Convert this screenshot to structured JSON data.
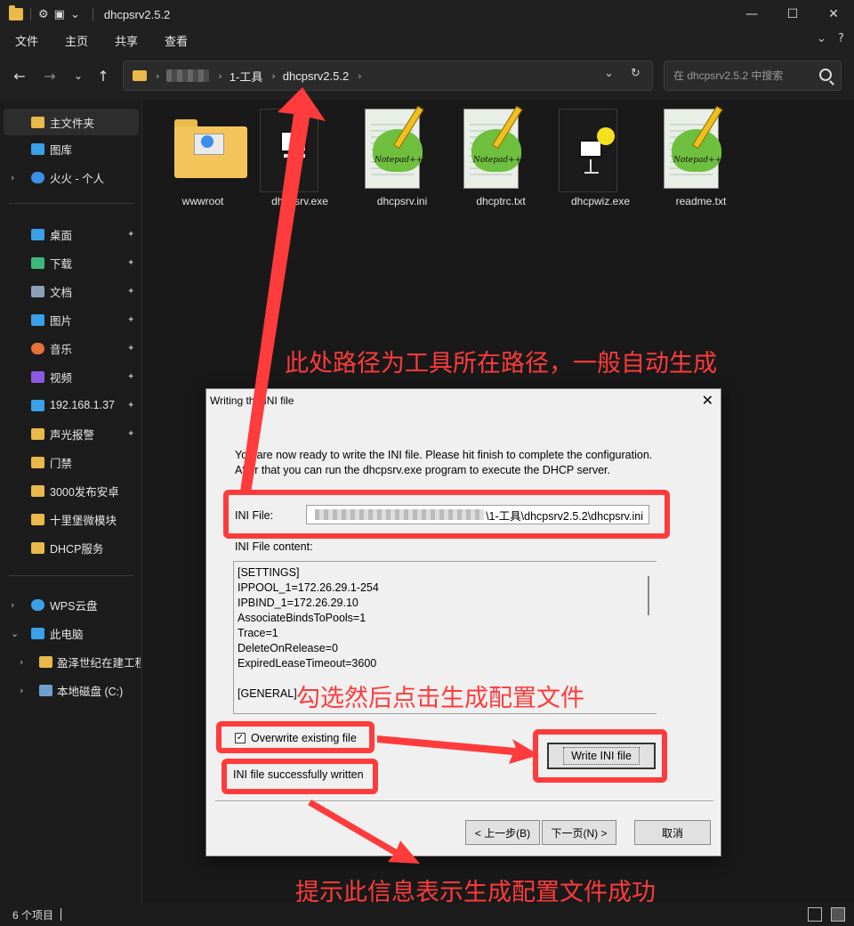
{
  "window": {
    "title": "dhcpsrv2.5.2",
    "minimize_glyph": "—",
    "maximize_glyph": "☐",
    "close_glyph": "✕"
  },
  "menu": {
    "items": [
      "文件",
      "主页",
      "共享",
      "查看"
    ],
    "collapse_glyph": "⌄",
    "help_glyph": "?"
  },
  "nav": {
    "breadcrumb": [
      "1-工具",
      "dhcpsrv2.5.2"
    ],
    "search_placeholder": "在 dhcpsrv2.5.2 中搜索"
  },
  "sidebar": {
    "items": [
      {
        "label": "主文件夹",
        "icon": "home-icon",
        "color": "#e9b949",
        "selected": true
      },
      {
        "label": "图库",
        "icon": "gallery-icon",
        "color": "#3aa0e8"
      },
      {
        "label": "火火 - 个人",
        "icon": "onedrive-icon",
        "color": "#3a8fe8",
        "chevron": "›"
      },
      {
        "label": "桌面",
        "icon": "desktop-icon",
        "color": "#3aa0e8",
        "pinned": true
      },
      {
        "label": "下载",
        "icon": "download-icon",
        "color": "#3cb878",
        "pinned": true
      },
      {
        "label": "文档",
        "icon": "document-icon",
        "color": "#8aa0b8",
        "pinned": true
      },
      {
        "label": "图片",
        "icon": "pictures-icon",
        "color": "#3aa0e8",
        "pinned": true
      },
      {
        "label": "音乐",
        "icon": "music-icon",
        "color": "#e8703a",
        "pinned": true
      },
      {
        "label": "视频",
        "icon": "video-icon",
        "color": "#8a5ae0",
        "pinned": true
      },
      {
        "label": "192.168.1.37",
        "icon": "network-drive-icon",
        "color": "#3aa0e8",
        "pinned": true
      },
      {
        "label": "声光报警",
        "icon": "folder-icon",
        "color": "#e9b949",
        "pinned": true
      },
      {
        "label": "门禁",
        "icon": "folder-icon",
        "color": "#e9b949"
      },
      {
        "label": "3000发布安卓",
        "icon": "folder-icon",
        "color": "#e9b949"
      },
      {
        "label": "十里堡微模块",
        "icon": "folder-icon",
        "color": "#e9b949"
      },
      {
        "label": "DHCP服务",
        "icon": "folder-icon",
        "color": "#e9b949"
      },
      {
        "label": "WPS云盘",
        "icon": "cloud-icon",
        "color": "#3aa0e8",
        "chevron": "›"
      },
      {
        "label": "此电脑",
        "icon": "computer-icon",
        "color": "#3aa0e8",
        "chevron": "⌄"
      },
      {
        "label": "盈泽世纪在建工程",
        "icon": "folder-icon",
        "color": "#e9b949",
        "chevron": "›"
      },
      {
        "label": "本地磁盘 (C:)",
        "icon": "drive-icon",
        "color": "#6fa0d0",
        "chevron": "›"
      }
    ],
    "pin_glyph": "📌"
  },
  "files": [
    {
      "name": "wwwroot",
      "type": "folder"
    },
    {
      "name": "dhcpsrv.exe",
      "type": "exe"
    },
    {
      "name": "dhcpsrv.ini",
      "type": "notepad"
    },
    {
      "name": "dhcptrc.txt",
      "type": "notepad"
    },
    {
      "name": "dhcpwiz.exe",
      "type": "wizard"
    },
    {
      "name": "readme.txt",
      "type": "notepad"
    }
  ],
  "status": {
    "count": "6 个项目"
  },
  "dialog": {
    "title": "Writing the INI file",
    "intro": "You are now ready to write the INI file. Please hit finish to complete the configuration. After that you can run the dhcpsrv.exe program to execute the DHCP server.",
    "ini_file_label": "INI File:",
    "ini_file_path_visible": "\\1-工具\\dhcpsrv2.5.2\\dhcpsrv.ini",
    "content_label": "INI File content:",
    "content_lines": [
      "[SETTINGS]",
      "IPPOOL_1=172.26.29.1-254",
      "IPBIND_1=172.26.29.10",
      "AssociateBindsToPools=1",
      "Trace=1",
      "DeleteOnRelease=0",
      "ExpiredLeaseTimeout=3600",
      "",
      "[GENERAL]"
    ],
    "overwrite_label": "Overwrite existing file",
    "overwrite_checked": true,
    "write_button": "Write INI file",
    "success_message": "INI file successfully written",
    "back_button": "< 上一步(B)",
    "next_button": "下一页(N) >",
    "cancel_button": "取消"
  },
  "annotations": {
    "path_note": "此处路径为工具所在路径，一般自动生成",
    "check_note": "勾选然后点击生成配置文件",
    "success_note": "提示此信息表示生成配置文件成功",
    "color": "#ff3b3b"
  }
}
